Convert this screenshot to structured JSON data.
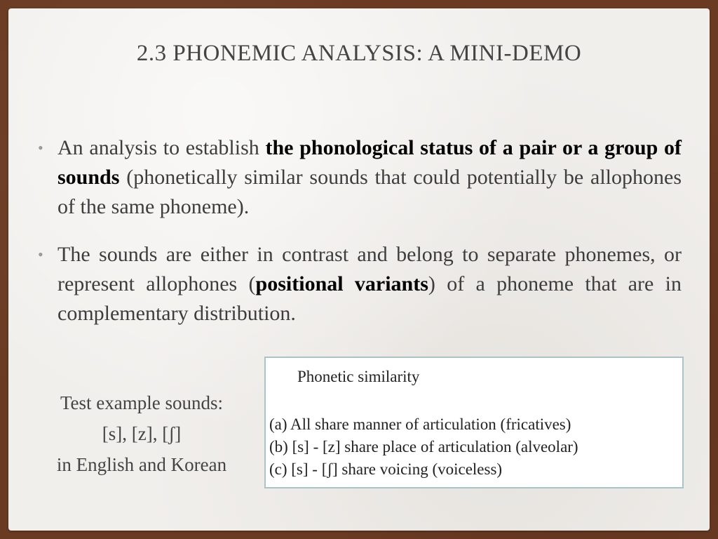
{
  "slide": {
    "title": "2.3 PHONEMIC ANALYSIS: A MINI-DEMO",
    "bullets": [
      {
        "pre": "An analysis to establish ",
        "bold": "the phonological status of a pair or a group of sounds",
        "post": " (phonetically similar sounds that could potentially be allophones of the same phoneme)."
      },
      {
        "pre": "The sounds are either in contrast and belong to separate phonemes, or represent allophones (",
        "bold": "positional variants",
        "post": ") of a phoneme that are in complementary distribution."
      }
    ],
    "test_example": {
      "line1": "Test example sounds:",
      "line2": "[s], [z], [ʃ]",
      "line3": "in English and Korean"
    },
    "similarity_box": {
      "title": "Phonetic similarity",
      "items": [
        "(a) All share manner of articulation (fricatives)",
        "(b) [s] - [z] share place of articulation (alveolar)",
        "(c) [s] - [ʃ] share voicing (voiceless)"
      ]
    }
  },
  "colors": {
    "frame": "#6b3a22",
    "paper": "#f1efec",
    "title_text": "#444444",
    "body_text": "#3d3d3d",
    "box_border": "#a9c3c6"
  }
}
